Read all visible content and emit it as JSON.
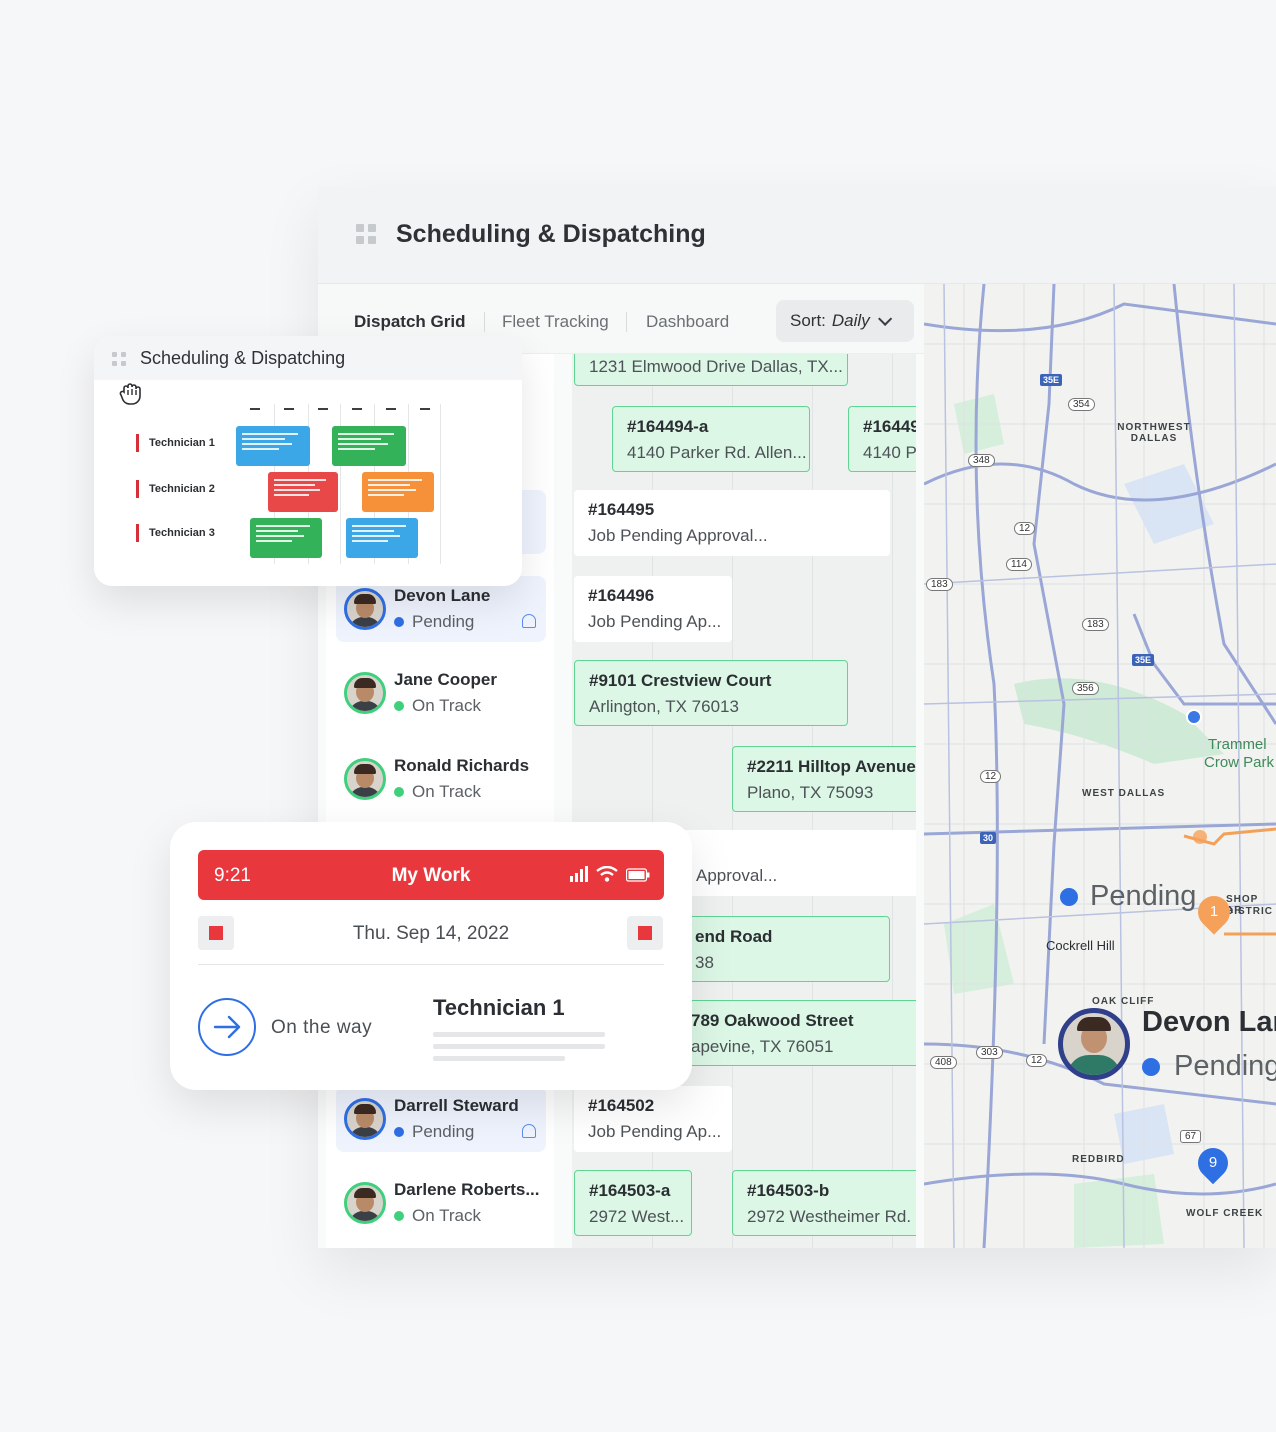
{
  "main_window": {
    "title": "Scheduling & Dispatching",
    "tabs": [
      "Dispatch Grid",
      "Fleet Tracking",
      "Dashboard"
    ],
    "sort": {
      "label": "Sort:",
      "value": "Daily"
    }
  },
  "technicians": [
    {
      "name": "Devon Lane",
      "status": "Pending"
    },
    {
      "name": "Jane Cooper",
      "status": "On Track"
    },
    {
      "name": "Ronald Richards",
      "status": "On Track"
    },
    {
      "name": "Darrell Steward",
      "status": "Pending"
    },
    {
      "name": "Darlene Roberts...",
      "status": "On Track"
    }
  ],
  "jobs": [
    {
      "id": "",
      "text": "1231 Elmwood Drive Dallas, TX..."
    },
    {
      "id": "#164494-a",
      "text": "4140 Parker Rd. Allen..."
    },
    {
      "id": "#16449",
      "text": "4140 Pa"
    },
    {
      "id": "#164495",
      "text": "Job Pending Approval..."
    },
    {
      "id": "#164496",
      "text": "Job Pending Ap..."
    },
    {
      "id": "#9101 Crestview Court",
      "text": "Arlington, TX 76013"
    },
    {
      "id": "#2211 Hilltop Avenue",
      "text": "Plano, TX 75093"
    },
    {
      "id": "",
      "text": "Approval..."
    },
    {
      "id": "end Road",
      "text": "38"
    },
    {
      "id": "789 Oakwood Street",
      "text": "apevine, TX 76051"
    },
    {
      "id": "#164502",
      "text": "Job Pending Ap..."
    },
    {
      "id": "#164503-a",
      "text": "2972 West..."
    },
    {
      "id": "#164503-b",
      "text": "2972 Westheimer Rd. S"
    }
  ],
  "schedule_card": {
    "title": "Scheduling & Dispatching",
    "rows": [
      "Technician 1",
      "Technician 2",
      "Technician 3"
    ],
    "colors": {
      "blue": "#3ba7e6",
      "green": "#34b25a",
      "red": "#e94848",
      "orange": "#f6913a"
    }
  },
  "mywork": {
    "time": "9:21",
    "title": "My Work",
    "date": "Thu. Sep 14, 2022",
    "status": "On the way",
    "technician": "Technician 1"
  },
  "map": {
    "labels": [
      "NORTHWEST DALLAS",
      "WEST DALLAS",
      "Cockrell Hill",
      "OAK CLIFF",
      "REDBIRD",
      "WOLF CREEK",
      "Trammel",
      "Crow Park",
      "SHOP AR",
      "DISTRIC"
    ],
    "shields": [
      "35E",
      "354",
      "348",
      "12",
      "114",
      "183",
      "183",
      "35E",
      "356",
      "12",
      "30",
      "408",
      "303",
      "12",
      "67"
    ],
    "overlay": {
      "status": "Pending",
      "person": "Devon Lar",
      "person_status": "Pending",
      "marker_orange": "1",
      "marker_blue": "9"
    }
  },
  "colors": {
    "accent_red": "#e8383d",
    "accent_blue": "#2f6fe4",
    "on_track_green": "#3fd07c",
    "card_green": "#dcf7e6"
  }
}
